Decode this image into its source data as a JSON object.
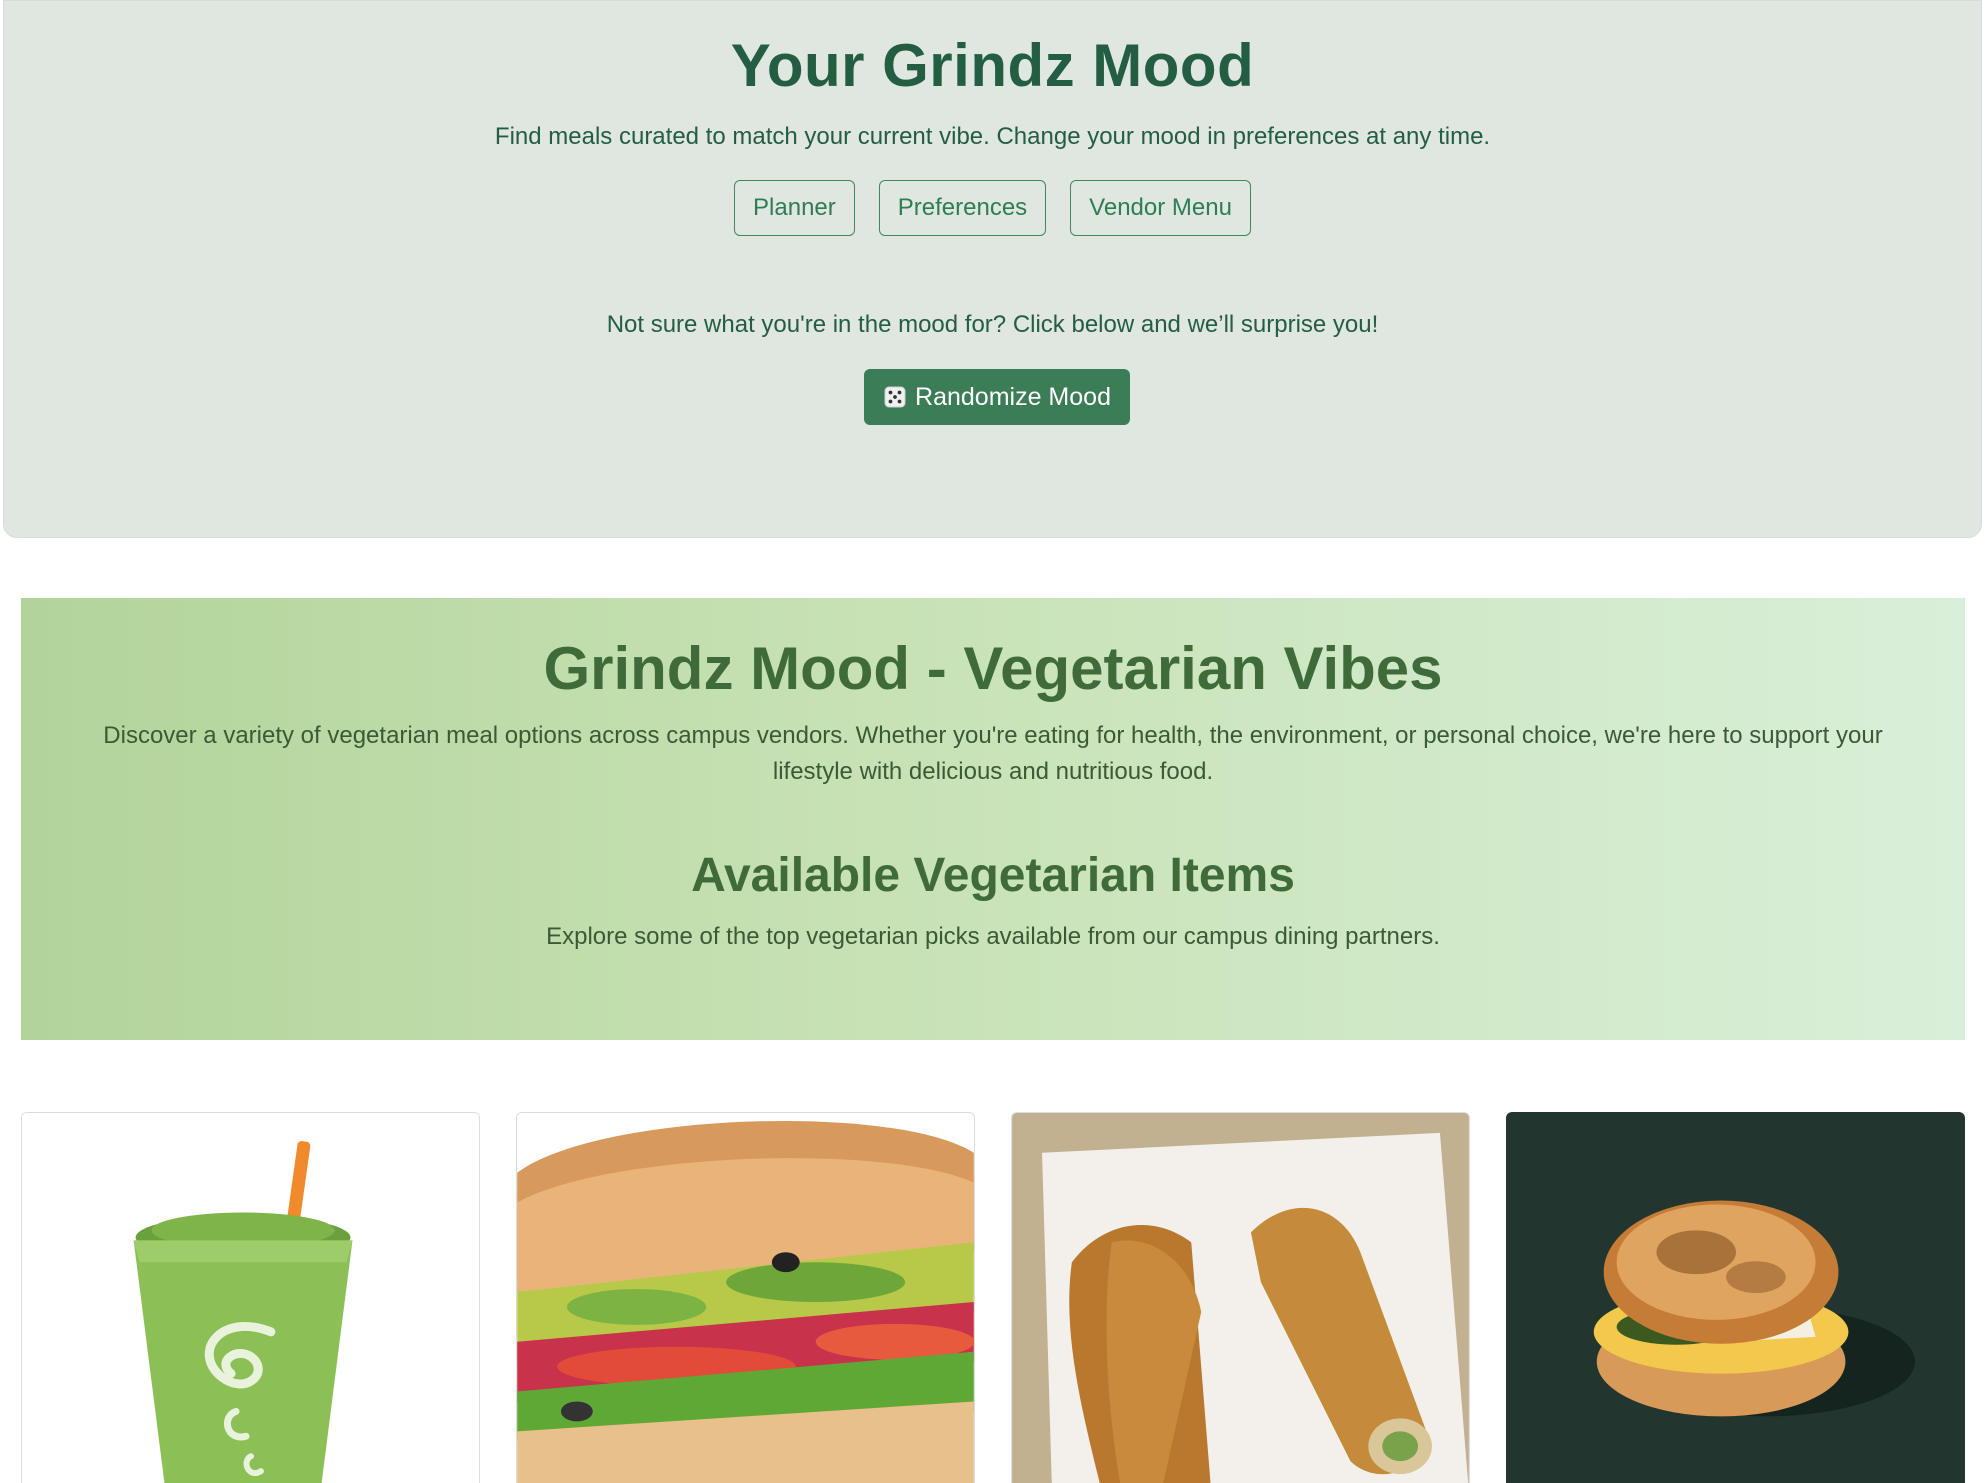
{
  "mood_panel": {
    "title": "Your Grindz Mood",
    "subtitle": "Find meals curated to match your current vibe. Change your mood in preferences at any time.",
    "nav_buttons": [
      {
        "label": "Planner"
      },
      {
        "label": "Preferences"
      },
      {
        "label": "Vendor Menu"
      }
    ],
    "surprise_text": "Not sure what you're in the mood for? Click below and we’ll surprise you!",
    "randomize_label": "Randomize Mood",
    "randomize_icon": "dice-icon"
  },
  "veg_banner": {
    "title": "Grindz Mood - Vegetarian Vibes",
    "description": "Discover a variety of vegetarian meal options across campus vendors. Whether you're eating for health, the environment, or personal choice, we're here to support your lifestyle with delicious and nutritious food.",
    "items_title": "Available Vegetarian Items",
    "items_subtitle": "Explore some of the top vegetarian picks available from our campus dining partners."
  },
  "items": [
    {
      "image": "green-smoothie-image"
    },
    {
      "image": "veggie-sub-sandwich-image"
    },
    {
      "image": "spring-rolls-image"
    },
    {
      "image": "egg-pesto-sandwich-image"
    }
  ],
  "colors": {
    "panel_bg": "#e0e7e1",
    "primary_green": "#3a7d57",
    "heading_green": "#245e42",
    "banner_start": "#b2d49a",
    "banner_end": "#d9efd9"
  }
}
